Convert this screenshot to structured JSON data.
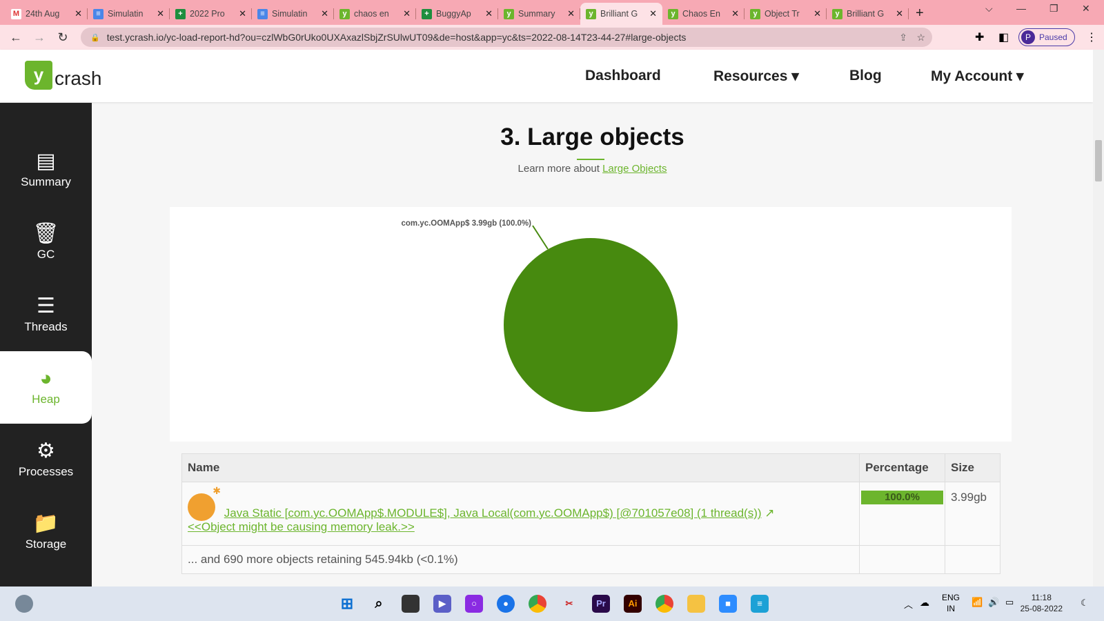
{
  "browser": {
    "tabs": [
      {
        "label": "24th Aug",
        "icon": "gmail-icon",
        "color": "#fff",
        "glyph": "M",
        "fg": "#d33"
      },
      {
        "label": "Simulatin",
        "icon": "docs-icon",
        "color": "#4a86e8",
        "glyph": "≡",
        "fg": "#fff"
      },
      {
        "label": "2022 Pro",
        "icon": "sheets-icon",
        "color": "#1e8e3e",
        "glyph": "+",
        "fg": "#fff"
      },
      {
        "label": "Simulatin",
        "icon": "docs-icon",
        "color": "#4a86e8",
        "glyph": "≡",
        "fg": "#fff"
      },
      {
        "label": "chaos en",
        "icon": "ycrash-icon",
        "color": "#6cb52d",
        "glyph": "y",
        "fg": "#fff"
      },
      {
        "label": "BuggyAp",
        "icon": "sheets-icon",
        "color": "#1e8e3e",
        "glyph": "+",
        "fg": "#fff"
      },
      {
        "label": "Summary",
        "icon": "ycrash-icon",
        "color": "#6cb52d",
        "glyph": "y",
        "fg": "#fff"
      },
      {
        "label": "Brilliant G",
        "icon": "ycrash-icon",
        "color": "#6cb52d",
        "glyph": "y",
        "fg": "#fff",
        "active": true
      },
      {
        "label": "Chaos En",
        "icon": "ycrash-icon",
        "color": "#6cb52d",
        "glyph": "y",
        "fg": "#fff"
      },
      {
        "label": "Object Tr",
        "icon": "ycrash-icon",
        "color": "#6cb52d",
        "glyph": "y",
        "fg": "#fff"
      },
      {
        "label": "Brilliant G",
        "icon": "ycrash-icon",
        "color": "#6cb52d",
        "glyph": "y",
        "fg": "#fff"
      }
    ],
    "url_host": "test.ycrash.io",
    "url_rest": "/yc-load-report-hd?ou=czlWbG0rUko0UXAxazlSbjZrSUlwUT09&de=host&app=yc&ts=2022-08-14T23-44-27#large-objects",
    "profile_initial": "P",
    "profile_status": "Paused"
  },
  "header": {
    "logo_y": "y",
    "logo_text": "crash",
    "menu": [
      "Dashboard",
      "Resources ▾",
      "Blog",
      "My Account ▾"
    ]
  },
  "sidebar": [
    {
      "label": "Summary",
      "icon": "summary-icon",
      "glyph": "▤"
    },
    {
      "label": "GC",
      "icon": "trash-icon",
      "glyph": "🗑"
    },
    {
      "label": "Threads",
      "icon": "threads-list-icon",
      "glyph": "☰"
    },
    {
      "label": "Heap",
      "icon": "heap-pie-icon",
      "glyph": "◕",
      "active": true
    },
    {
      "label": "Processes",
      "icon": "processes-icon",
      "glyph": "⚙"
    },
    {
      "label": "Storage",
      "icon": "folder-icon",
      "glyph": "📁"
    }
  ],
  "section": {
    "title": "3. Large objects",
    "learn_prefix": "Learn more about ",
    "learn_link": "Large Objects"
  },
  "chart_data": {
    "type": "pie",
    "slices": [
      {
        "label": "com.yc.OOMApp$ 3.99gb (100.0%)",
        "value": 100.0,
        "color": "#478a0f"
      }
    ]
  },
  "table": {
    "headers": [
      "Name",
      "Percentage",
      "Size"
    ],
    "row": {
      "name_link": "Java Static [com.yc.OOMApp$.MODULE$], Java Local(com.yc.OOMApp$) [@701057e08] (1 thread(s))",
      "leak_link": "<<Object might be causing memory leak.>>",
      "percentage": "100.0%",
      "percentage_value": 100.0,
      "size": "3.99gb"
    },
    "footer": "... and 690 more objects retaining 545.94kb (<0.1%)"
  },
  "taskbar": {
    "lang1": "ENG",
    "lang2": "IN",
    "time": "11:18",
    "date": "25-08-2022"
  }
}
